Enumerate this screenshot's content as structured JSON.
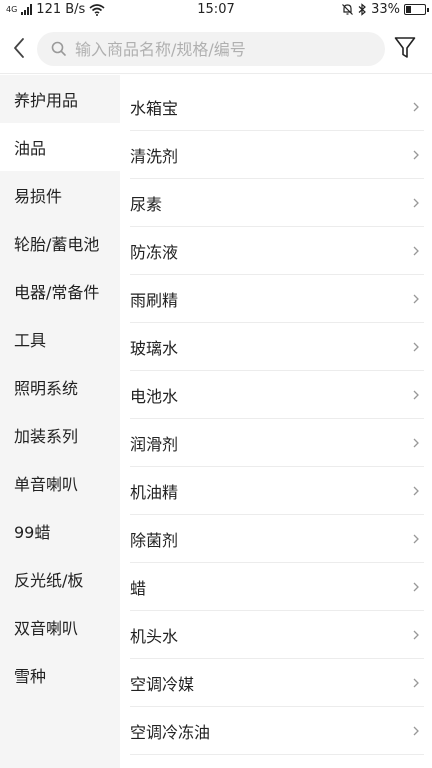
{
  "status_bar": {
    "network": "4G",
    "speed": "121 B/s",
    "time": "15:07",
    "battery": "33%",
    "battery_level": 0.33
  },
  "search": {
    "placeholder": "输入商品名称/规格/编号"
  },
  "categories": [
    "养护用品",
    "油品",
    "易损件",
    "轮胎/蓄电池",
    "电器/常备件",
    "工具",
    "照明系统",
    "加装系列",
    "单音喇叭",
    "99蜡",
    "反光纸/板",
    "双音喇叭",
    "雪种"
  ],
  "selected_category": "养护用品",
  "subcategories": [
    "水箱宝",
    "清洗剂",
    "尿素",
    "防冻液",
    "雨刷精",
    "玻璃水",
    "电池水",
    "润滑剂",
    "机油精",
    "除菌剂",
    "蜡",
    "机头水",
    "空调冷媒",
    "空调冷冻油"
  ],
  "colors": {
    "sidebar_bg": "#f5f5f5",
    "divider": "#ececec",
    "placeholder": "#b0b0b0"
  }
}
